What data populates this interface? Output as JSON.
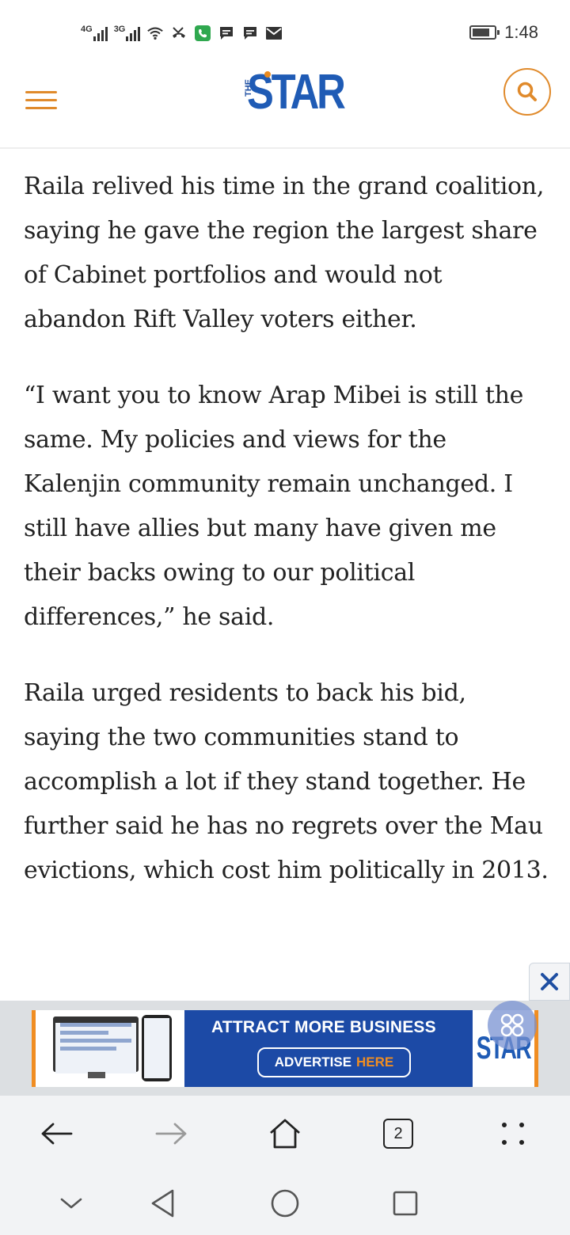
{
  "status_bar": {
    "net1_label": "4G",
    "net2_label": "3G",
    "time": "1:48",
    "battery_level": 0.8,
    "icons": [
      "wifi-icon",
      "missed-call-icon",
      "phone-app-icon",
      "message-icon",
      "message-icon",
      "mail-icon"
    ]
  },
  "header": {
    "logo_the": "THE",
    "logo_star": "STAR",
    "menu_icon": "hamburger-menu-icon",
    "search_icon": "search-icon"
  },
  "article": {
    "paragraphs": [
      "Raila relived his time in the grand coalition, saying he gave the region the largest share of Cabinet portfolios and would not abandon Rift Valley voters either.",
      "“I want you to know Arap Mibei is still the same. My policies and views for the Kalenjin community remain unchanged. I still have allies but many have given me their backs owing to our political differences,” he said.",
      "Raila urged residents to back his bid, saying the two communities stand to accomplish a lot if they stand together. He further said he has no regrets over the Mau evictions, which cost him politically in 2013."
    ]
  },
  "ad": {
    "title": "ATTRACT MORE BUSINESS",
    "cta_main": "ADVERTISE",
    "cta_accent": "HERE",
    "logo_text": "STAR",
    "close_icon": "close-icon",
    "colors": {
      "banner": "#1c4aa6",
      "accent": "#f08d22"
    }
  },
  "browser_toolbar": {
    "tab_count": "2",
    "icons": [
      "back-arrow-icon",
      "forward-arrow-icon",
      "home-icon",
      "tabs-icon",
      "more-options-icon"
    ]
  },
  "system_nav": {
    "icons": [
      "collapse-chevron-icon",
      "back-triangle-icon",
      "home-circle-icon",
      "recents-square-icon"
    ]
  },
  "colors": {
    "brand_blue": "#1f5bb5",
    "header_orange": "#e08a2b",
    "text": "#222222"
  }
}
